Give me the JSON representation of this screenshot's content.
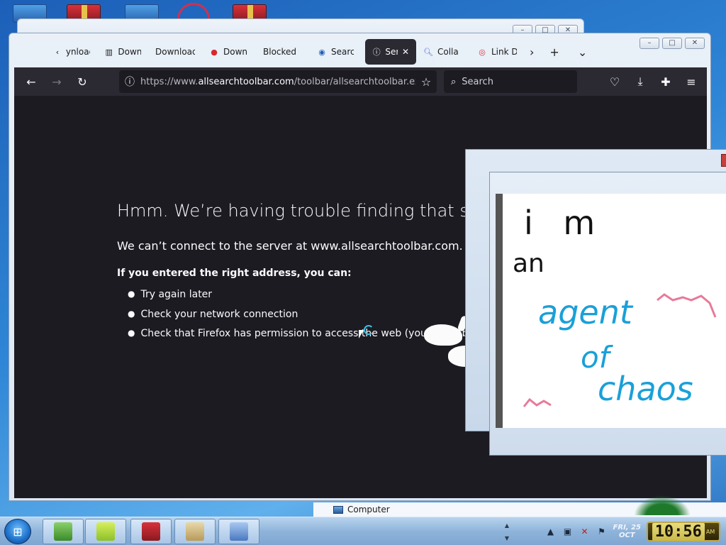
{
  "browser": {
    "tabs": [
      {
        "label": "ynload",
        "icon": "chevron-left-icon"
      },
      {
        "label": "Down",
        "icon": "library-icon"
      },
      {
        "label": "Download",
        "icon": ""
      },
      {
        "label": "Down",
        "icon": "mega-icon"
      },
      {
        "label": "Blocked",
        "icon": ""
      },
      {
        "label": "Search",
        "icon": "brand-icon"
      },
      {
        "label": "Ser",
        "icon": "info-icon",
        "active": true
      },
      {
        "label": "Colla",
        "icon": "search-icon"
      },
      {
        "label": "Link D",
        "icon": "vivaldi-icon"
      }
    ],
    "url": {
      "prefix": "https://www.",
      "host": "allsearchtoolbar.com",
      "path": "/toolbar/allsearchtoolbar.exe"
    },
    "search_placeholder": "Search"
  },
  "error_page": {
    "title": "Hmm. We’re having trouble finding that site.",
    "description": "We can’t connect to the server at www.allsearchtoolbar.com.",
    "hint": "If you entered the right address, you can:",
    "suggestions": [
      "Try again later",
      "Check your network connection",
      "Check that Firefox has permission to access the web (you might be co"
    ]
  },
  "notes": {
    "line1": "i m",
    "line2": "an",
    "line3": "agent",
    "line4": "of",
    "line5": "chaos"
  },
  "explorer": {
    "label": "Computer"
  },
  "taskbar": {
    "date_line1": "FRI, 25",
    "date_line2": "OCT",
    "time": "10:56",
    "ampm": "AM"
  },
  "colors": {
    "error_bg": "#1c1b22",
    "toolbar_bg": "#2b2a33",
    "ink_blue": "#1aa0d8",
    "ink_pink": "#e87a9a"
  }
}
